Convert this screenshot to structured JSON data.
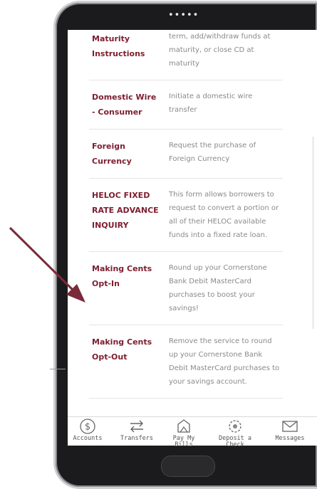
{
  "list": {
    "rows": [
      {
        "name": "Deposit\nMaturity\nInstructions",
        "desc": "Deposit at maturity, change term, add/withdraw funds at maturity, or close CD at maturity"
      },
      {
        "name": "Domestic Wire - Consumer",
        "desc": "Initiate a domestic wire transfer"
      },
      {
        "name": "Foreign Currency",
        "desc": "Request the purchase of Foreign Currency"
      },
      {
        "name": "HELOC FIXED RATE ADVANCE INQUIRY",
        "desc": "This form allows borrowers to request to convert a portion or all of their HELOC available funds into a fixed rate loan."
      },
      {
        "name": "Making Cents Opt-In",
        "desc": "Round up your Cornerstone Bank Debit MasterCard purchases to boost your savings!"
      },
      {
        "name": "Making Cents Opt-Out",
        "desc": "Remove the service to round up your Cornerstone Bank Debit MasterCard purchases to your savings account."
      }
    ]
  },
  "tabbar": {
    "accounts": "Accounts",
    "transfers": "Transfers",
    "pay_bills": "Pay My Bills",
    "deposit_check": "Deposit a Check",
    "messages": "Messages"
  },
  "colors": {
    "accent": "#7d1d2f",
    "arrow": "#7a2a3a"
  }
}
